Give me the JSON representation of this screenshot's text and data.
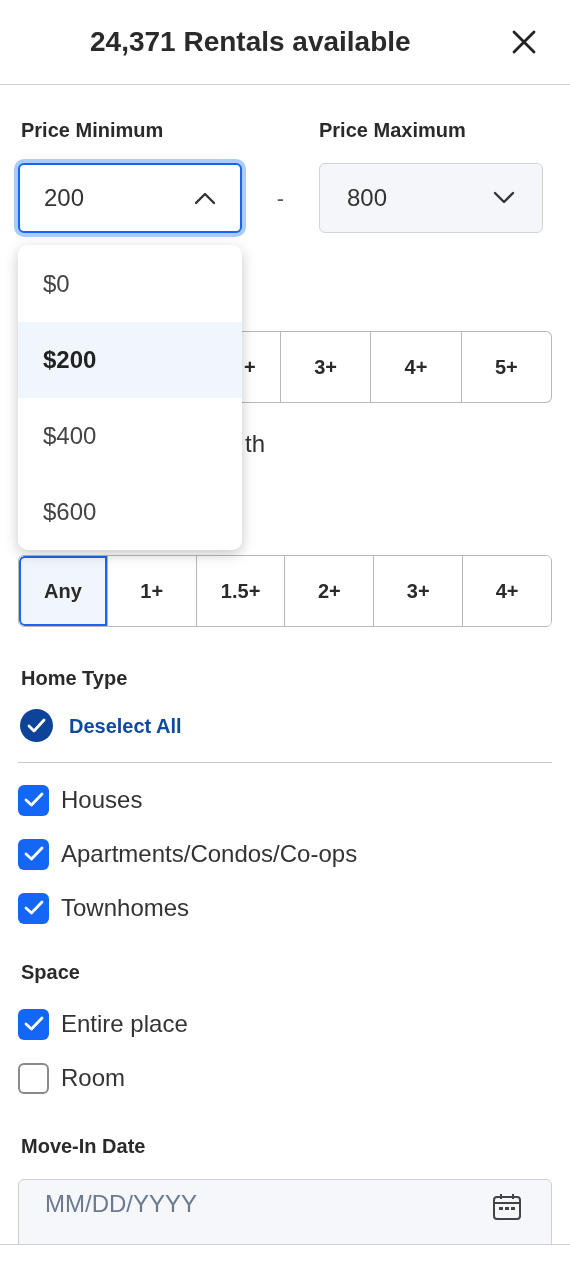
{
  "header": {
    "title": "24,371 Rentals available"
  },
  "price": {
    "min_label": "Price Minimum",
    "max_label": "Price Maximum",
    "min_value": "200",
    "min_open": true,
    "separator": "-",
    "max_value": "800",
    "max_open": false
  },
  "min_dropdown": [
    {
      "label": "$0",
      "selected": false
    },
    {
      "label": "$200",
      "selected": true
    },
    {
      "label": "$400",
      "selected": false
    },
    {
      "label": "$600",
      "selected": false
    }
  ],
  "beds": [
    {
      "label": "+",
      "selected": false
    },
    {
      "label": "3+",
      "selected": false
    },
    {
      "label": "4+",
      "selected": false
    },
    {
      "label": "5+",
      "selected": false
    }
  ],
  "bath_option_text": "th",
  "baths": [
    {
      "label": "Any",
      "selected": true
    },
    {
      "label": "1+",
      "selected": false
    },
    {
      "label": "1.5+",
      "selected": false
    },
    {
      "label": "2+",
      "selected": false
    },
    {
      "label": "3+",
      "selected": false
    },
    {
      "label": "4+",
      "selected": false
    }
  ],
  "home_type": {
    "title": "Home Type",
    "toggle_all": "Deselect All",
    "options": [
      {
        "label": "Houses",
        "checked": true
      },
      {
        "label": "Apartments/Condos/Co-ops",
        "checked": true
      },
      {
        "label": "Townhomes",
        "checked": true
      }
    ]
  },
  "space": {
    "title": "Space",
    "options": [
      {
        "label": "Entire place",
        "checked": true
      },
      {
        "label": "Room",
        "checked": false
      }
    ]
  },
  "move_in": {
    "title": "Move-In Date",
    "placeholder": "MM/DD/YYYY"
  }
}
